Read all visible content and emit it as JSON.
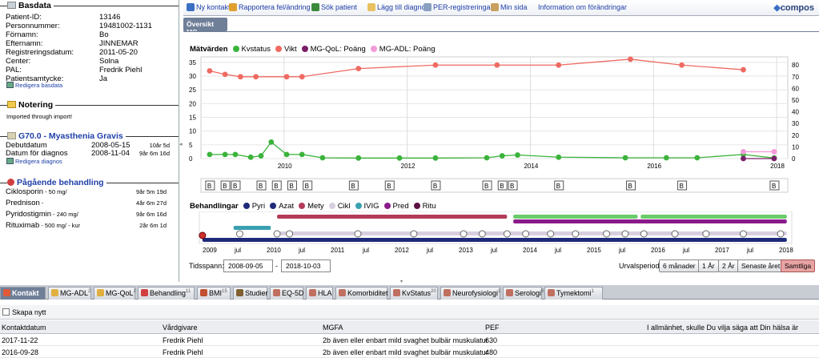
{
  "basdata": {
    "title": "Basdata",
    "rows": [
      {
        "label": "Patient-ID:",
        "value": "13146"
      },
      {
        "label": "Personnummer:",
        "value": "19481002-1131"
      },
      {
        "label": "Förnamn:",
        "value": "Bo"
      },
      {
        "label": "Efternamn:",
        "value": "JINNEMAR"
      },
      {
        "label": "Registreringsdatum:",
        "value": "2011-05-20"
      },
      {
        "label": "Center:",
        "value": "Solna"
      },
      {
        "label": "PAL:",
        "value": "Fredrik Piehl"
      },
      {
        "label": "Patientsamtycke:",
        "value": "Ja"
      }
    ],
    "edit_link": "Redigera basdata"
  },
  "notering": {
    "title": "Notering",
    "text": "Imported through import!"
  },
  "diagnosis": {
    "title": "G70.0 - Myasthenia Gravis",
    "rows": [
      {
        "label": "Debutdatum",
        "date": "2008-05-15",
        "age": "10år 5d"
      },
      {
        "label": "Datum för diagnos",
        "date": "2008-11-04",
        "age": "9år 6m 16d"
      }
    ],
    "edit_link": "Redigera diagnos"
  },
  "treatment": {
    "title": "Pågående behandling",
    "items": [
      {
        "name": "Ciklosporin",
        "dose": " - 50 mg/",
        "duration": "9år 5m 19d"
      },
      {
        "name": "Prednison",
        "dose": " -",
        "duration": "4år 6m 27d"
      },
      {
        "name": "Pyridostigmin",
        "dose": " - 240 mg/",
        "duration": "9år 6m 16d"
      },
      {
        "name": "Rituximab",
        "dose": " - 500 mg/ - kur",
        "duration": "2år 6m 1d"
      }
    ]
  },
  "toolbar": {
    "items": [
      {
        "label": "Ny kontakt",
        "icon": "new-contact-icon",
        "color": "#3a6fc4"
      },
      {
        "label": "Rapportera fel/ändring",
        "icon": "report-icon",
        "color": "#e0a030"
      },
      {
        "label": "Sök patient",
        "icon": "search-patient-icon",
        "color": "#3b8a3b"
      },
      {
        "label": "Lägg till diagnos",
        "icon": "add-diagnosis-icon",
        "color": "#e8c060"
      },
      {
        "label": "PER-registreringar",
        "icon": "per-icon",
        "color": "#8aa0c0"
      },
      {
        "label": "Min sida",
        "icon": "home-icon",
        "color": "#c8a060"
      },
      {
        "label": "Information om förändringar",
        "icon": "",
        "color": ""
      }
    ],
    "logo": "compos"
  },
  "overview_tab": "Översikt MG",
  "chart_data": [
    {
      "type": "line",
      "title": "Mätvärden",
      "x_ticks": [
        "2010",
        "2012",
        "2014",
        "2016",
        "2018"
      ],
      "y_left_ticks": [
        0,
        5,
        10,
        15,
        20,
        25,
        30,
        35
      ],
      "y_right_ticks": [
        0,
        10,
        20,
        30,
        40,
        50,
        60,
        70,
        80
      ],
      "series": [
        {
          "name": "Kvstatus",
          "color": "#3bb33b",
          "axis": "left",
          "x": [
            "2008-10",
            "2009-01",
            "2009-03",
            "2009-06",
            "2009-08",
            "2009-10",
            "2010-01",
            "2010-04",
            "2010-08",
            "2011-03",
            "2011-11",
            "2012-06",
            "2013-04",
            "2013-07",
            "2013-10",
            "2014-06",
            "2015-07",
            "2016-03",
            "2016-09",
            "2017-06",
            "2017-12"
          ],
          "values": [
            1.5,
            1.5,
            1.5,
            0.5,
            1,
            6,
            1.5,
            1.5,
            0.3,
            0.2,
            0.2,
            0.2,
            0.3,
            1,
            1.3,
            0.5,
            0.3,
            0.3,
            0.3,
            1.5,
            0.2
          ]
        },
        {
          "name": "Vikt",
          "color": "#ef6a62",
          "axis": "right",
          "x": [
            "2008-10",
            "2009-01",
            "2009-04",
            "2009-07",
            "2010-01",
            "2010-04",
            "2011-03",
            "2012-06",
            "2013-06",
            "2014-06",
            "2015-08",
            "2016-06",
            "2017-06"
          ],
          "values": [
            75,
            72,
            70,
            70,
            70,
            70,
            77,
            80,
            80,
            80,
            85,
            80,
            76
          ]
        },
        {
          "name": "MG-QoL: Poäng",
          "color": "#7a1f6a",
          "axis": "right",
          "x": [
            "2017-06",
            "2017-12"
          ],
          "values": [
            0,
            0
          ]
        },
        {
          "name": "MG-ADL: Poäng",
          "color": "#f29ad8",
          "axis": "left",
          "x": [
            "2017-06",
            "2017-12"
          ],
          "values": [
            2.5,
            2.5
          ]
        }
      ]
    },
    {
      "type": "timeline",
      "title": "Behandlingar",
      "x_ticks": [
        "2009",
        "jul",
        "2010",
        "jul",
        "2011",
        "jul",
        "2012",
        "jul",
        "2013",
        "jul",
        "2014",
        "jul",
        "2015",
        "jul",
        "2016",
        "jul",
        "2017",
        "jul",
        "2018"
      ],
      "series": [
        {
          "name": "Pyri",
          "color": "#1f2a7a"
        },
        {
          "name": "Azat",
          "color": "#1f2a7a"
        },
        {
          "name": "Mety",
          "color": "#b33a5a"
        },
        {
          "name": "Cikl",
          "color": "#d8cfe0"
        },
        {
          "name": "IVIG",
          "color": "#3aa0b0"
        },
        {
          "name": "Pred",
          "color": "#8a1a8a"
        },
        {
          "name": "Ritu",
          "color": "#5a1040"
        }
      ],
      "b_marker_label": "B"
    }
  ],
  "timespan": {
    "label": "Tidsspann:",
    "from": "2008-09-05",
    "sep": "-",
    "to": "2018-10-03",
    "period_label": "Urvalsperiod:",
    "buttons": [
      "6 månader",
      "1 År",
      "2 År",
      "Senaste året",
      "Samtliga"
    ]
  },
  "tabs": [
    {
      "label": "Kontakt",
      "count": "",
      "icon": "contact-icon",
      "color": "#e05a3a"
    },
    {
      "label": "MG-ADL",
      "count": "2",
      "icon": "adl-icon",
      "color": "#e0b040"
    },
    {
      "label": "MG-QoL",
      "count": "2",
      "icon": "qol-icon",
      "color": "#e0b040"
    },
    {
      "label": "Behandling",
      "count": "11",
      "icon": "behandling-icon",
      "color": "#d04040"
    },
    {
      "label": "BMI",
      "count": "15",
      "icon": "bmi-icon",
      "color": "#c05030"
    },
    {
      "label": "Studier",
      "count": "",
      "icon": "studier-icon",
      "color": "#806030"
    },
    {
      "label": "EQ-5D",
      "count": "",
      "icon": "eq5d-icon",
      "color": "#c07060"
    },
    {
      "label": "HLA",
      "count": "",
      "icon": "hla-icon",
      "color": "#c07060"
    },
    {
      "label": "Komorbiditet",
      "count": "",
      "icon": "komorbiditet-icon",
      "color": "#c07060"
    },
    {
      "label": "KvStatus",
      "count": "20",
      "icon": "kvstatus-icon",
      "color": "#c07060"
    },
    {
      "label": "Neurofysiologi",
      "count": "1",
      "icon": "neurofysiologi-icon",
      "color": "#c07060"
    },
    {
      "label": "Serologi",
      "count": "6",
      "icon": "serologi-icon",
      "color": "#c07060"
    },
    {
      "label": "Tymektomi",
      "count": "1",
      "icon": "tymektomi-icon",
      "color": "#c07060"
    }
  ],
  "new_button": "Skapa nytt",
  "table": {
    "headers": [
      "Kontaktdatum",
      "Vårdgivare",
      "MGFA",
      "PEF",
      "I allmänhet, skulle Du vilja säga att Din hälsa är"
    ],
    "rows": [
      [
        "2017-11-22",
        "Fredrik Piehl",
        "2b även eller enbart mild svaghet bulbär muskulatur",
        "630",
        ""
      ],
      [
        "2016-09-28",
        "Fredrik Piehl",
        "2b även eller enbart mild svaghet bulbär muskulatur",
        "480",
        ""
      ]
    ]
  }
}
